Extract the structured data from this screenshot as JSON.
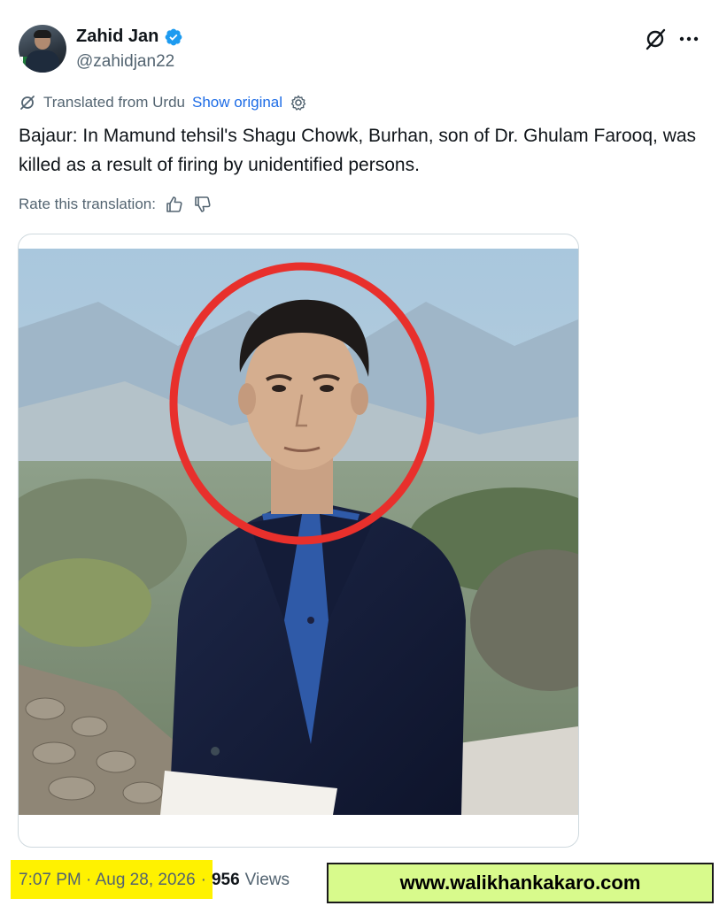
{
  "author": {
    "display_name": "Zahid Jan",
    "handle": "@zahidjan22",
    "verified": true,
    "verified_color": "#1d9bf0"
  },
  "header_actions": {
    "grok_icon": "grok-icon",
    "more_icon": "more-icon"
  },
  "translation": {
    "label": "Translated from Urdu",
    "show_original": "Show original",
    "rate_label": "Rate this translation:"
  },
  "tweet": {
    "text": "Bajaur: In Mamund tehsil's Shagu Chowk, Burhan, son of Dr. Ghulam Farooq, was killed as a result of firing by unidentified persons."
  },
  "media": {
    "annotation_color": "#e8302c"
  },
  "meta": {
    "timestamp": "7:07 PM · Aug 28, 2026",
    "separator": "·",
    "views_count": "956",
    "views_label": "Views",
    "highlight_color": "#fff200"
  },
  "watermark": {
    "text": "www.walikhankakaro.com",
    "background": "#d8fa8c"
  },
  "colors": {
    "link": "#1d6ce6",
    "secondary_text": "#536471",
    "primary_text": "#0f1419"
  }
}
